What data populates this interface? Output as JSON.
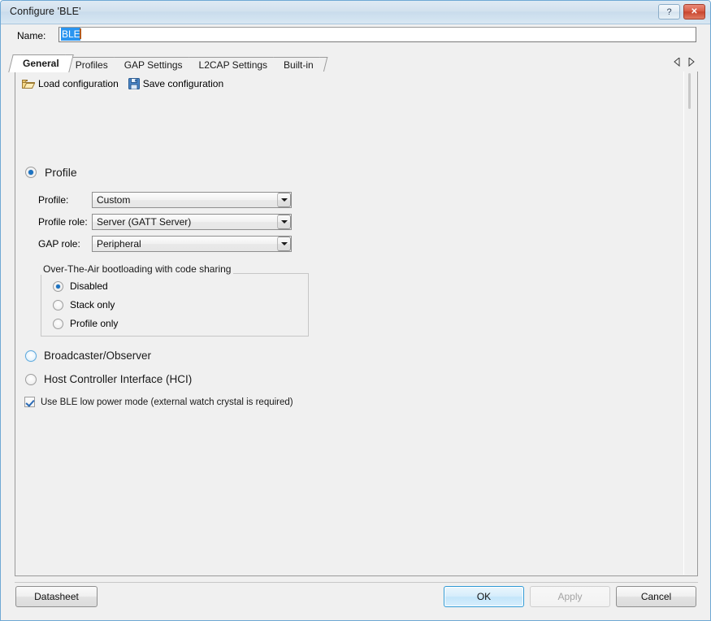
{
  "window": {
    "title": "Configure 'BLE'",
    "help_button": "?",
    "close_button": "✕"
  },
  "name_field": {
    "label": "Name:",
    "value": "BLE",
    "selected": true
  },
  "tabs": {
    "items": [
      {
        "label": "General",
        "active": true
      },
      {
        "label": "Profiles",
        "active": false
      },
      {
        "label": "GAP Settings",
        "active": false
      },
      {
        "label": "L2CAP Settings",
        "active": false
      },
      {
        "label": "Built-in",
        "active": false
      }
    ],
    "scroll_left": "◁",
    "scroll_right": "▷"
  },
  "toolbar": {
    "load_label": "Load configuration",
    "save_label": "Save configuration"
  },
  "general": {
    "profile_option": {
      "label": "Profile",
      "selected": true
    },
    "fields": [
      {
        "label": "Profile:",
        "value": "Custom"
      },
      {
        "label": "Profile role:",
        "value": "Server (GATT Server)"
      },
      {
        "label": "GAP role:",
        "value": "Peripheral"
      }
    ],
    "ota_group": {
      "title": "Over-The-Air bootloading with code sharing",
      "options": [
        {
          "label": "Disabled",
          "selected": true
        },
        {
          "label": "Stack only",
          "selected": false
        },
        {
          "label": "Profile only",
          "selected": false
        }
      ]
    },
    "broadcaster_option": {
      "label": "Broadcaster/Observer",
      "selected": false,
      "hover": true
    },
    "hci_option": {
      "label": "Host Controller Interface (HCI)",
      "selected": false
    },
    "low_power_checkbox": {
      "label": "Use BLE low power mode (external watch crystal is required)",
      "checked": true
    }
  },
  "footer": {
    "datasheet": "Datasheet",
    "ok": "OK",
    "apply": "Apply",
    "cancel": "Cancel"
  },
  "colors": {
    "accent_blue": "#2f9ad6",
    "selection_blue": "#2a95f0",
    "radio_dot": "#1c73c2",
    "close_red": "#c8462f"
  }
}
